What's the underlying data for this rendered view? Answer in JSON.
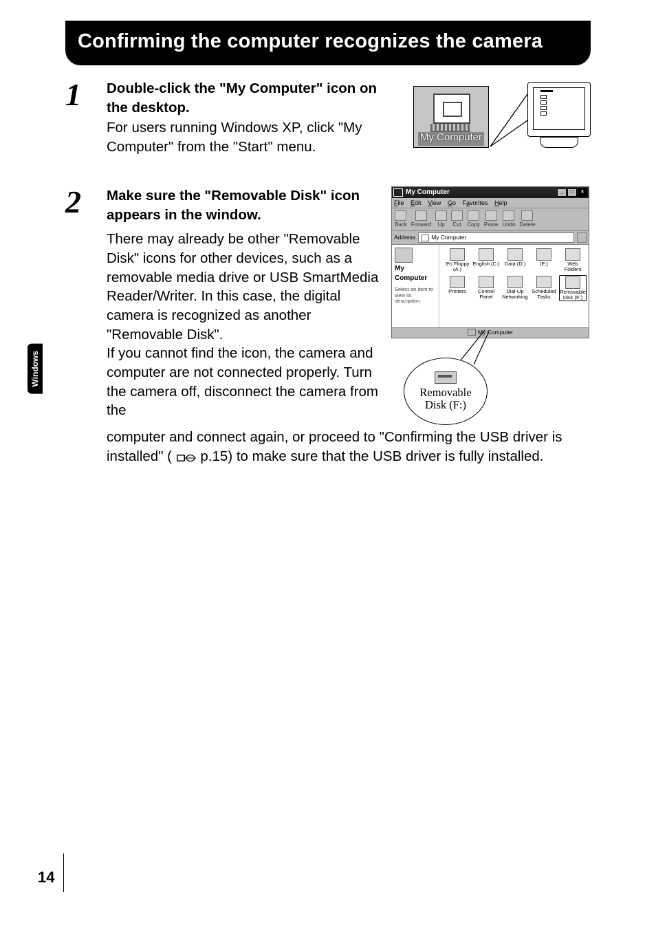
{
  "title": "Confirming the computer recognizes the camera",
  "side_tab": "Windows",
  "page_number": "14",
  "step1": {
    "number": "1",
    "headline": "Double-click the \"My Computer\" icon on the desktop.",
    "body": "For users running Windows XP, click \"My Computer\" from the \"Start\" menu.",
    "illus": {
      "icon_label": "My Computer"
    }
  },
  "step2": {
    "number": "2",
    "headline": "Make sure the \"Removable Disk\" icon appears in the window.",
    "para1": "There may already be other \"Removable Disk\" icons for other devices, such as a removable media drive or USB SmartMedia Reader/Writer. In this case, the digital camera is recognized as another \"Removable Disk\".",
    "para2a": "If you cannot find the icon, the camera and computer are not connected properly. Turn the camera off, disconnect the camera from the",
    "para2b_full": "computer and connect again, or proceed to \"Confirming the USB driver is installed\" (",
    "para2c": " p.15) to make sure that the USB driver is fully installed.",
    "explorer": {
      "title": "My Computer",
      "menu": {
        "file": "File",
        "edit": "Edit",
        "view": "View",
        "go": "Go",
        "fav": "Favorites",
        "help": "Help"
      },
      "toolbar": {
        "back": "Back",
        "fwd": "Forward",
        "up": "Up",
        "cut": "Cut",
        "copy": "Copy",
        "paste": "Paste",
        "undo": "Undo",
        "delete": "Delete"
      },
      "addr_label": "Address",
      "addr_value": "My Computer",
      "side": {
        "title": "My",
        "title2": "Computer",
        "desc": "Select an item to view its description."
      },
      "items": {
        "floppy": "3½ Floppy (A:)",
        "c": "English (C:)",
        "d": "Data (D:)",
        "e": "(E:)",
        "web": "Web Folders",
        "printers": "Printers",
        "cpanel": "Control Panel",
        "dialup": "Dial-Up Networking",
        "sched": "Scheduled Tasks",
        "removable": "Removable Disk (F:)"
      },
      "status": "My Computer"
    },
    "callout": {
      "line1": "Removable",
      "line2": "Disk (F:)"
    }
  }
}
